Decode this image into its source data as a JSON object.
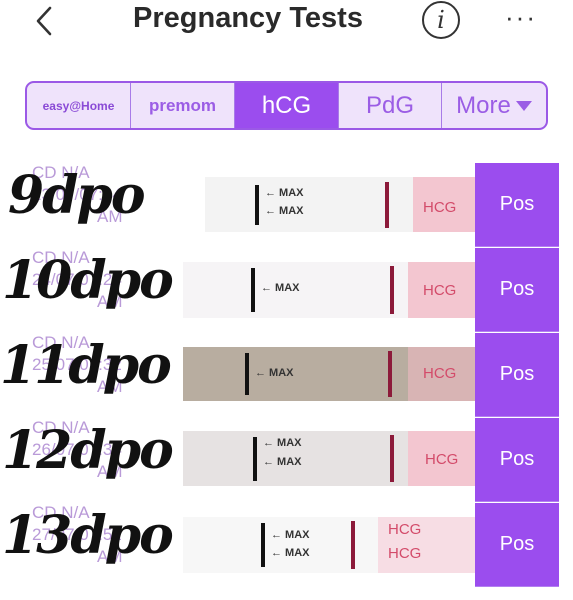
{
  "header": {
    "back_icon": "chevron-left-icon",
    "title": "Pregnancy Tests",
    "info_glyph": "i",
    "more_glyph": "···"
  },
  "tabs": [
    {
      "label": "easy@Home",
      "active": false
    },
    {
      "label": "premom",
      "active": false
    },
    {
      "label": "hCG",
      "active": true
    },
    {
      "label": "PdG",
      "active": false
    },
    {
      "label": "More",
      "active": false
    }
  ],
  "rows": [
    {
      "cd": "CD N/A",
      "date": "23/07/07:14",
      "ampm": "AM",
      "dpo": "9dpo",
      "result": "Pos",
      "max": "MAX",
      "hcg": "HCG"
    },
    {
      "cd": "CD N/A",
      "date": "24/07/07:24",
      "ampm": "AM",
      "dpo": "10dpo",
      "result": "Pos",
      "max": "MAX",
      "hcg": "HCG"
    },
    {
      "cd": "CD N/A",
      "date": "25/07/07:32",
      "ampm": "AM",
      "dpo": "11dpo",
      "result": "Pos",
      "max": "MAX",
      "hcg": "HCG"
    },
    {
      "cd": "CD N/A",
      "date": "26/07/07:34",
      "ampm": "AM",
      "dpo": "12dpo",
      "result": "Pos",
      "max": "MAX",
      "hcg": "HCG"
    },
    {
      "cd": "CD N/A",
      "date": "27/07/07:52",
      "ampm": "AM",
      "dpo": "13dpo",
      "result": "Pos",
      "max": "MAX",
      "hcg": "HCG"
    }
  ],
  "colors": {
    "accent": "#9b4dee",
    "tab_bg": "#efe3fb",
    "muted_text": "#b99ad8"
  }
}
